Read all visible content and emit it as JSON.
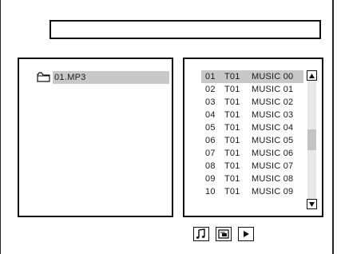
{
  "header": {
    "title": ""
  },
  "folders": {
    "items": [
      {
        "label": "01.MP3",
        "icon": "folder-icon",
        "selected": true
      }
    ]
  },
  "tracks": {
    "items": [
      {
        "num": "01",
        "title": "T01",
        "name": "MUSIC 00",
        "selected": true
      },
      {
        "num": "02",
        "title": "T01",
        "name": "MUSIC 01",
        "selected": false
      },
      {
        "num": "03",
        "title": "T01",
        "name": "MUSIC 02",
        "selected": false
      },
      {
        "num": "04",
        "title": "T01",
        "name": "MUSIC 03",
        "selected": false
      },
      {
        "num": "05",
        "title": "T01",
        "name": "MUSIC 04",
        "selected": false
      },
      {
        "num": "06",
        "title": "T01",
        "name": "MUSIC 05",
        "selected": false
      },
      {
        "num": "07",
        "title": "T01",
        "name": "MUSIC 06",
        "selected": false
      },
      {
        "num": "08",
        "title": "T01",
        "name": "MUSIC 07",
        "selected": false
      },
      {
        "num": "09",
        "title": "T01",
        "name": "MUSIC 08",
        "selected": false
      },
      {
        "num": "10",
        "title": "T01",
        "name": "MUSIC 09",
        "selected": false
      }
    ],
    "scroll_position": 0.5
  },
  "mode_buttons": [
    {
      "icon": "music-note-icon"
    },
    {
      "icon": "photo-icon"
    },
    {
      "icon": "play-icon"
    }
  ],
  "colors": {
    "highlight": "#c8c8c8",
    "border": "#111111",
    "scroll_track": "#e8e8e8"
  }
}
